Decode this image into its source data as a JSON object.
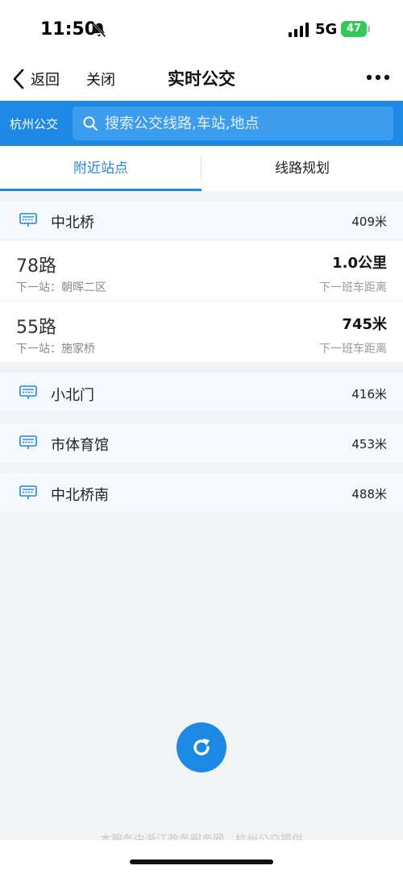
{
  "status": {
    "time": "11:50",
    "network": "5G",
    "battery": "47"
  },
  "nav": {
    "back_label": "返回",
    "close_label": "关闭",
    "title": "实时公交"
  },
  "search": {
    "city": "杭州公交",
    "placeholder": "搜索公交线路,车站,地点"
  },
  "tabs": [
    {
      "label": "附近站点",
      "active": true
    },
    {
      "label": "线路规划",
      "active": false
    }
  ],
  "stations": [
    {
      "name": "中北桥",
      "distance": "409米",
      "routes": [
        {
          "name": "78路",
          "next_stop": "下一站：朝晖二区",
          "distance": "1.0公里",
          "distance_label": "下一班车距离"
        },
        {
          "name": "55路",
          "next_stop": "下一站：施家桥",
          "distance": "745米",
          "distance_label": "下一班车距离"
        }
      ]
    },
    {
      "name": "小北门",
      "distance": "416米",
      "routes": []
    },
    {
      "name": "市体育馆",
      "distance": "453米",
      "routes": []
    },
    {
      "name": "中北桥南",
      "distance": "488米",
      "routes": []
    }
  ],
  "footer": {
    "text": "本服务由浙江政务服务网、杭州公交提供"
  },
  "colors": {
    "accent": "#1e88e5",
    "battery": "#34c759"
  }
}
